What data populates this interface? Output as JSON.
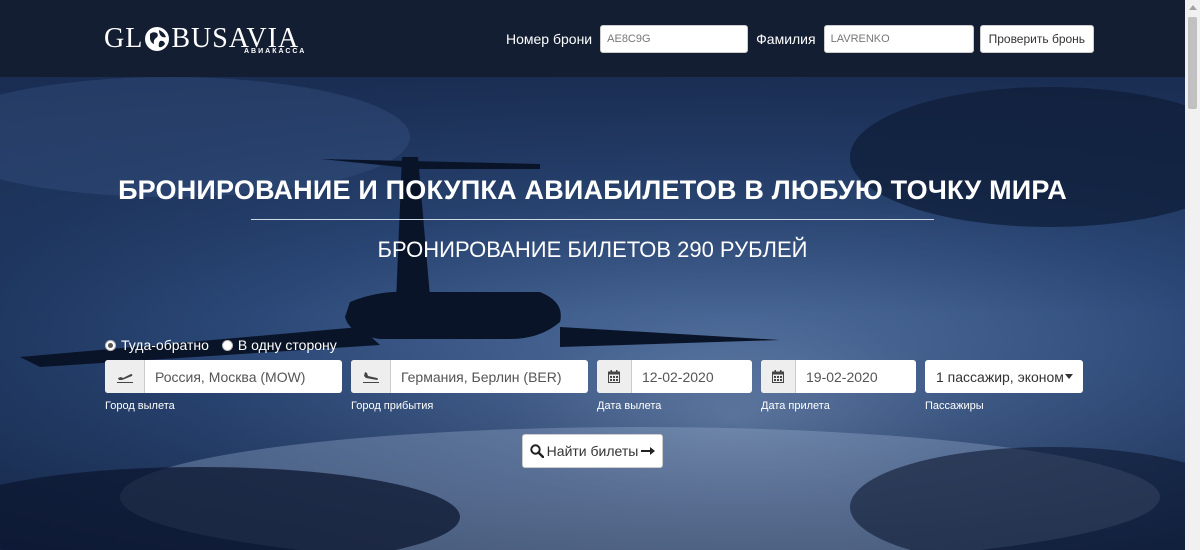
{
  "header": {
    "logo_left": "GL",
    "logo_mid": "BUS",
    "logo_right": "AVIA",
    "logo_sub": "АВИАКАССА",
    "pnr_label": "Номер брони",
    "pnr_value": "AE8C9G",
    "surname_label": "Фамилия",
    "surname_value": "LAVRENKO",
    "check_button": "Проверить бронь"
  },
  "hero": {
    "title": "БРОНИРОВАНИЕ И ПОКУПКА АВИАБИЛЕТОВ В ЛЮБУЮ ТОЧКУ МИРА",
    "subtitle": "БРОНИРОВАНИЕ БИЛЕТОВ 290 РУБЛЕЙ"
  },
  "search": {
    "trip_types": [
      {
        "label": "Туда-обратно",
        "selected": true
      },
      {
        "label": "В одну сторону",
        "selected": false
      }
    ],
    "from": {
      "value": "Россия, Москва (MOW)",
      "caption": "Город вылета",
      "icon": "takeoff-icon"
    },
    "to": {
      "value": "Германия, Берлин (BER)",
      "caption": "Город прибытия",
      "icon": "landing-icon"
    },
    "depart": {
      "value": "12-02-2020",
      "caption": "Дата вылета",
      "icon": "calendar-icon"
    },
    "return": {
      "value": "19-02-2020",
      "caption": "Дата прилета",
      "icon": "calendar-icon"
    },
    "passengers": {
      "value": "1 пассажир, эконом",
      "caption": "Пассажиры"
    },
    "search_button": "Найти билеты"
  },
  "colors": {
    "header_bg": "#141e33",
    "hero_accent": "#2d4a7a"
  }
}
